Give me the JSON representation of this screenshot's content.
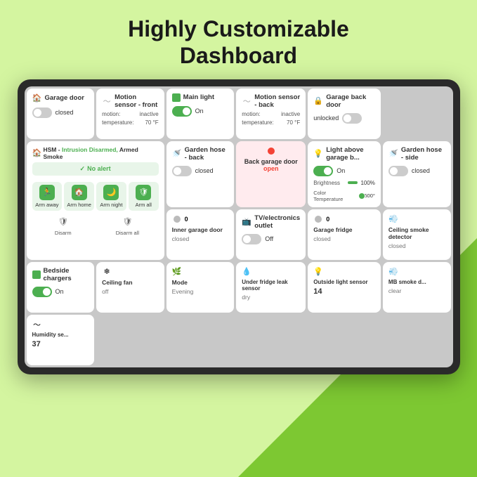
{
  "page": {
    "title_line1": "Highly Customizable",
    "title_line2": "Dashboard"
  },
  "tiles": {
    "garage_door": {
      "title": "Garage door",
      "status": "closed"
    },
    "motion_front": {
      "title": "Motion sensor - front",
      "motion": "inactive",
      "temperature": "70 °F"
    },
    "main_light": {
      "title": "Main light",
      "status": "On"
    },
    "motion_back": {
      "title": "Motion sensor - back",
      "motion": "inactive",
      "temperature": "70 °F"
    },
    "garage_back_door": {
      "title": "Garage back door",
      "status": "unlocked"
    },
    "hsm": {
      "title": "HSM -",
      "intrusion": "Intrusion Disarmed,",
      "smoke": "Armed Smoke",
      "no_alert": "No alert",
      "buttons": [
        "Arm away",
        "Arm home",
        "Arm night",
        "Arm all"
      ],
      "disarm_buttons": [
        "Disarm",
        "Disarm all"
      ]
    },
    "garden_hose_back": {
      "title": "Garden hose - back",
      "status": "closed"
    },
    "back_garage_door_alert": {
      "title": "Back garage door",
      "status": "open"
    },
    "light_above_garage": {
      "title": "Light above garage b...",
      "toggle_status": "On",
      "brightness": "100%",
      "color_temp": "2500°"
    },
    "garden_hose_side": {
      "title": "Garden hose - side",
      "status": "closed"
    },
    "inner_garage_door": {
      "title": "Inner garage door",
      "status": "closed",
      "count": "0"
    },
    "tv_electronics": {
      "title": "TV/electronics outlet",
      "status": "Off"
    },
    "garage_fridge": {
      "title": "Garage fridge",
      "status": "closed",
      "count": "0"
    },
    "ceiling_smoke": {
      "title": "Ceiling smoke detector",
      "status": "closed"
    },
    "bedside_chargers": {
      "title": "Bedside chargers",
      "status": "On"
    },
    "ceiling_fan": {
      "title": "Ceiling fan",
      "status": "off"
    },
    "mode": {
      "title": "Mode",
      "status": "Evening"
    },
    "under_fridge": {
      "title": "Under fridge leak sensor",
      "status": "dry"
    },
    "outside_light": {
      "title": "Outside light sensor",
      "value": "14"
    },
    "mb_smoke": {
      "title": "MB smoke d...",
      "status": "clear"
    },
    "humidity": {
      "title": "Humidity se...",
      "value": "37"
    }
  },
  "icons": {
    "home": "🏠",
    "motion": "〜",
    "light": "💡",
    "lock": "🔒",
    "hose": "🚿",
    "door": "🚪",
    "smoke": "💨",
    "sensor": "🌿",
    "fan": "❄",
    "leaf": "🌿",
    "arm_away": "🏃",
    "arm_home": "🏠",
    "arm_night": "🌙",
    "arm_all": "🛡",
    "disarm": "🛡",
    "check": "✓",
    "fridge": "🧊",
    "charger": "🔋",
    "tv": "📺",
    "thermometer": "🌡",
    "drop": "💧"
  }
}
